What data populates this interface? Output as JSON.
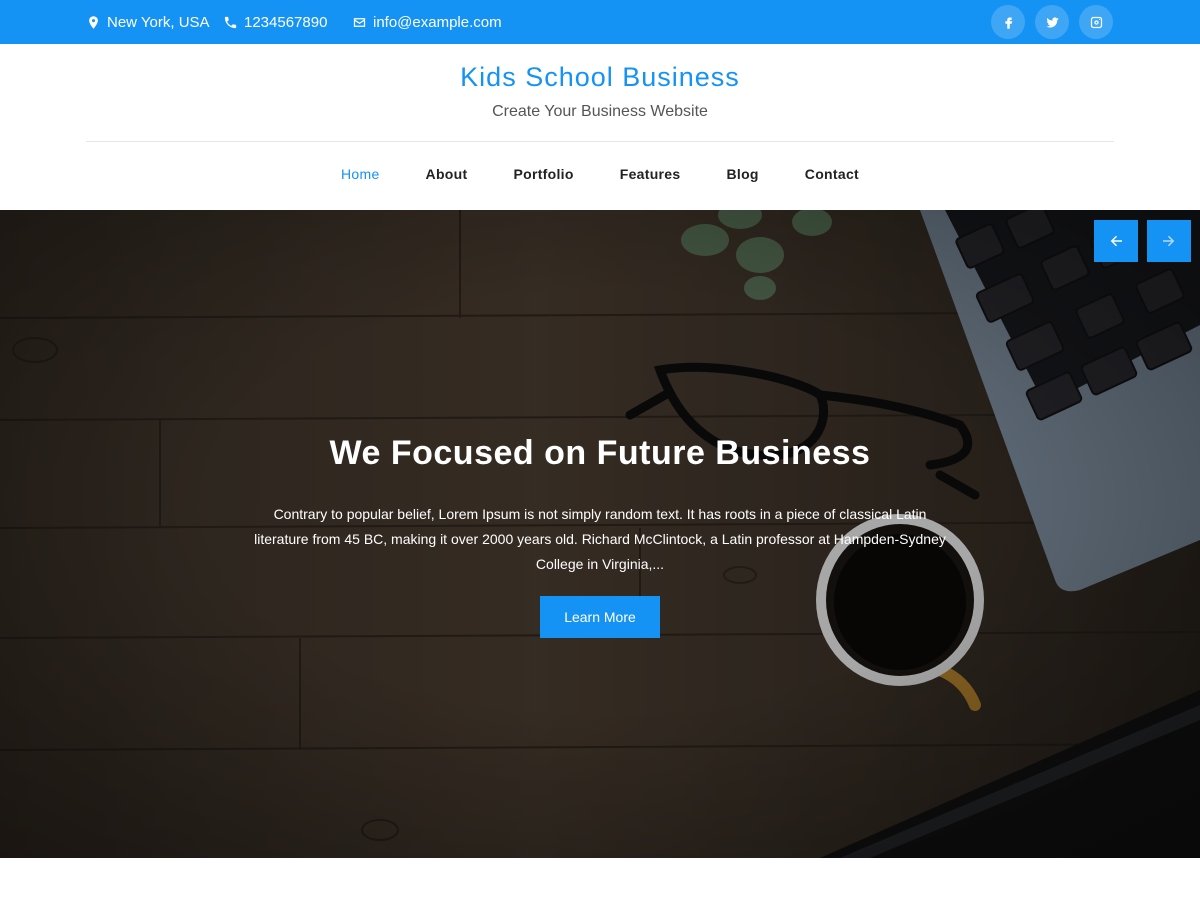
{
  "topbar": {
    "location": "New York, USA",
    "phone": "1234567890",
    "email": "info@example.com",
    "icons": {
      "location": "map-marker-icon",
      "phone": "phone-icon",
      "email": "envelope-icon",
      "social": [
        "facebook-icon",
        "twitter-icon",
        "instagram-icon"
      ]
    }
  },
  "header": {
    "brand": "Kids School Business",
    "tagline": "Create Your Business Website"
  },
  "nav": {
    "items": [
      {
        "label": "Home",
        "active": true
      },
      {
        "label": "About"
      },
      {
        "label": "Portfolio"
      },
      {
        "label": "Features"
      },
      {
        "label": "Blog"
      },
      {
        "label": "Contact"
      }
    ]
  },
  "hero": {
    "title": "We Focused on Future Business",
    "text": "Contrary to popular belief, Lorem Ipsum is not simply random text. It has roots in a piece of classical Latin literature from 45 BC, making it over 2000 years old. Richard McClintock, a Latin professor at Hampden-Sydney College in Virginia,...",
    "button": "Learn More",
    "prev_icon": "arrow-left-icon",
    "next_icon": "arrow-right-icon"
  },
  "colors": {
    "accent": "#1593f4"
  }
}
